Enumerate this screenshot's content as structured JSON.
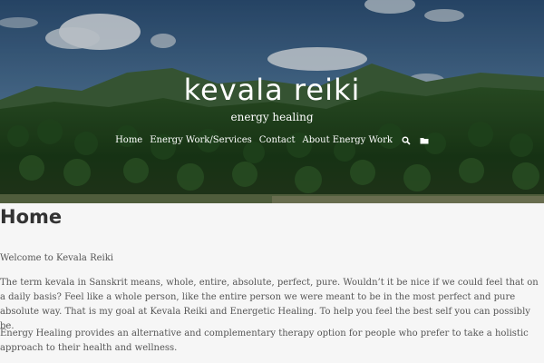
{
  "header": {
    "site_title": "kevala reiki",
    "tagline": "energy healing"
  },
  "nav": {
    "items": [
      {
        "label": "Home"
      },
      {
        "label": "Energy Work/Services"
      },
      {
        "label": "Contact"
      },
      {
        "label": "About Energy Work"
      }
    ],
    "icons": [
      "search-icon",
      "folder-icon"
    ]
  },
  "page": {
    "title": "Home",
    "paragraphs": [
      "Welcome to Kevala Reiki",
      "The term kevala in Sanskrit means, whole, entire, absolute, perfect, pure.  Wouldn’t it be nice if we could feel that on a daily basis?  Feel like a whole person, like the entire person we were meant to be in the most perfect and pure absolute way. That is my goal at Kevala Reiki and Energetic Healing. To help you feel the best self you can possibly be.",
      "Energy Healing provides an alternative and complementary therapy option for people who prefer to take a holistic approach to their health and wellness."
    ]
  },
  "colors": {
    "background": "#f6f6f6",
    "title_text": "#333333",
    "body_text": "#555555",
    "header_text": "#ffffff"
  }
}
